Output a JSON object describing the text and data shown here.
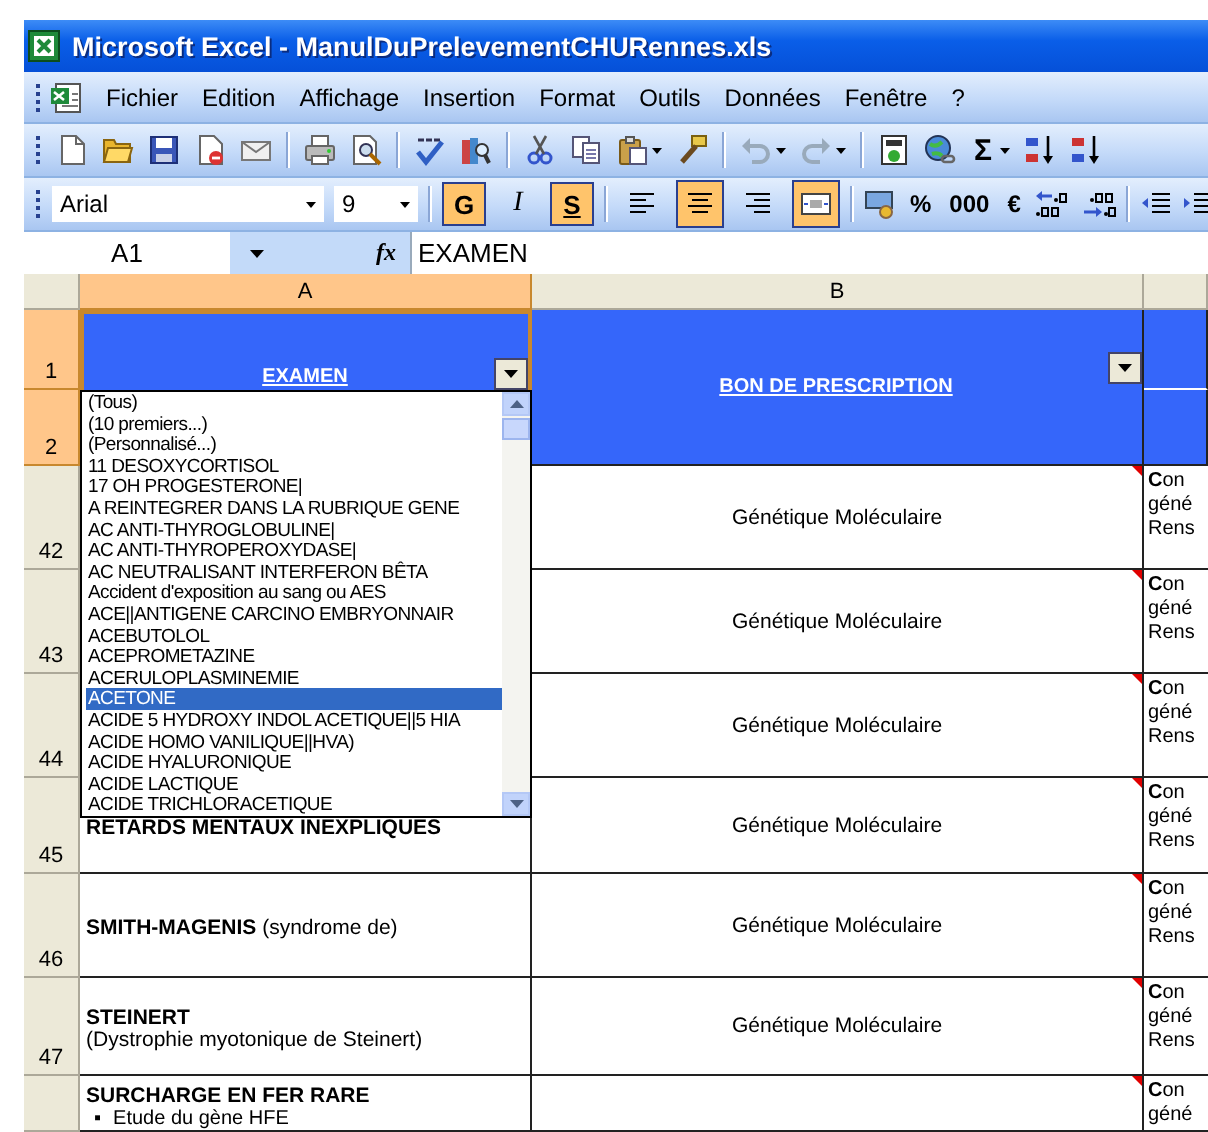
{
  "window": {
    "title": "Microsoft Excel - ManulDuPrelevementCHURennes.xls"
  },
  "menu": [
    "Fichier",
    "Edition",
    "Affichage",
    "Insertion",
    "Format",
    "Outils",
    "Données",
    "Fenêtre",
    "?"
  ],
  "standard_toolbar": {
    "autosum": "Σ"
  },
  "formatting_toolbar": {
    "font": "Arial",
    "size": "9",
    "styles": [
      {
        "label": "G",
        "on": true
      },
      {
        "label": "I",
        "on": false
      },
      {
        "label": "S",
        "on": true
      }
    ],
    "alignment": [
      {
        "selected": false
      },
      {
        "selected": true
      },
      {
        "selected": false
      }
    ],
    "merge_center": {
      "on": true
    },
    "number_formats": [
      "%",
      "000",
      "€"
    ]
  },
  "formula_bar": {
    "name_box": "A1",
    "fx": "fx",
    "value": "EXAMEN"
  },
  "sheet": {
    "columns": [
      {
        "label": "A",
        "selected": true
      },
      {
        "label": "B",
        "selected": false
      }
    ],
    "header": {
      "row_numbers": [
        {
          "label": "1",
          "selected": true
        },
        {
          "label": "2",
          "selected": true
        }
      ],
      "exam": "EXAMEN",
      "prescription": "BON DE PRESCRIPTION"
    },
    "rows": [
      {
        "number": "42",
        "selected": false,
        "prescription": "Génétique Moléculaire",
        "comment": true,
        "notes": [
          "**C**on",
          "géné",
          "Rens"
        ]
      },
      {
        "number": "43",
        "selected": false,
        "prescription": "Génétique Moléculaire",
        "comment": true,
        "notes": [
          "**C**on",
          "géné",
          "Rens"
        ]
      },
      {
        "number": "44",
        "selected": false,
        "prescription": "Génétique Moléculaire",
        "comment": true,
        "notes": [
          "**C**on",
          "géné",
          "Rens"
        ]
      },
      {
        "number": "45",
        "selected": false,
        "exam": [
          {
            "kind": "title",
            "text": "RETARDS MENTAUX INEXPLIQUES"
          }
        ],
        "prescription": "Génétique Moléculaire",
        "comment": true,
        "notes": [
          "**C**on",
          "géné",
          "Rens"
        ]
      },
      {
        "number": "46",
        "selected": false,
        "exam": [
          {
            "kind": "line",
            "text": "**SMITH-MAGENIS** (syndrome de)"
          }
        ],
        "prescription": "Génétique Moléculaire",
        "comment": true,
        "notes": [
          "**C**on",
          "géné",
          "Rens"
        ]
      },
      {
        "number": "47",
        "selected": false,
        "exam": [
          {
            "kind": "title",
            "text": "STEINERT"
          },
          {
            "kind": "line",
            "text": "(Dystrophie myotonique de Steinert)"
          }
        ],
        "prescription": "Génétique Moléculaire",
        "comment": true,
        "notes": [
          "**C**on",
          "géné",
          "Rens"
        ]
      },
      {
        "exam": [
          {
            "kind": "title",
            "text": "SURCHARGE EN FER RARE"
          },
          {
            "kind": "bullet",
            "marker": "▪",
            "text": "Etude du gène HFE"
          }
        ],
        "comment": true,
        "notes": [
          "**C**on",
          "géné"
        ]
      }
    ]
  },
  "autofilter_list": {
    "items": [
      {
        "label": "(Tous)",
        "selected": false
      },
      {
        "label": "(10 premiers...)",
        "selected": false
      },
      {
        "label": "(Personnalisé...)",
        "selected": false
      },
      {
        "label": "11 DESOXYCORTISOL",
        "selected": false
      },
      {
        "label": "17 OH PROGESTERONE|",
        "selected": false
      },
      {
        "label": "A REINTEGRER DANS LA RUBRIQUE GENE",
        "selected": false
      },
      {
        "label": "AC ANTI-THYROGLOBULINE|",
        "selected": false
      },
      {
        "label": "AC ANTI-THYROPEROXYDASE|",
        "selected": false
      },
      {
        "label": "AC NEUTRALISANT INTERFERON BÊTA",
        "selected": false
      },
      {
        "label": "Accident d'exposition au sang ou AES",
        "selected": false
      },
      {
        "label": "ACE||ANTIGENE CARCINO EMBRYONNAIR",
        "selected": false
      },
      {
        "label": "ACEBUTOLOL",
        "selected": false
      },
      {
        "label": "ACEPROMETAZINE",
        "selected": false
      },
      {
        "label": "ACERULOPLASMINEMIE",
        "selected": false
      },
      {
        "label": "ACETONE",
        "selected": true
      },
      {
        "label": "ACIDE 5 HYDROXY INDOL ACETIQUE||5 HIA",
        "selected": false
      },
      {
        "label": "ACIDE HOMO VANILIQUE||HVA)",
        "selected": false
      },
      {
        "label": "ACIDE HYALURONIQUE",
        "selected": false
      },
      {
        "label": "ACIDE LACTIQUE",
        "selected": false
      },
      {
        "label": "ACIDE TRICHLORACETIQUE",
        "selected": false
      }
    ]
  }
}
